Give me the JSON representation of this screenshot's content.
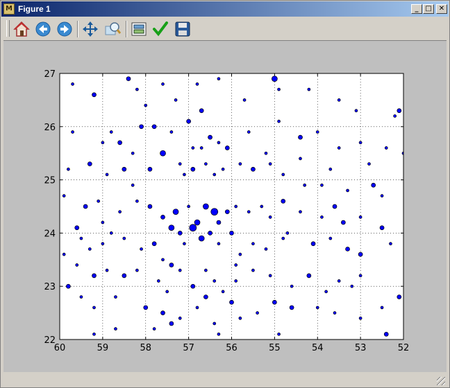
{
  "window": {
    "title": "Figure 1"
  },
  "titlebar_buttons": {
    "minimize": "_",
    "maximize": "□",
    "close": "✕"
  },
  "toolbar": {
    "items": [
      {
        "name": "home-icon",
        "tooltip": "Home"
      },
      {
        "name": "back-icon",
        "tooltip": "Back"
      },
      {
        "name": "forward-icon",
        "tooltip": "Forward"
      },
      {
        "name": "pan-icon",
        "tooltip": "Pan"
      },
      {
        "name": "zoom-icon",
        "tooltip": "Zoom"
      },
      {
        "name": "subplots-icon",
        "tooltip": "Configure subplots"
      },
      {
        "name": "edit-icon",
        "tooltip": "Edit"
      },
      {
        "name": "save-icon",
        "tooltip": "Save"
      }
    ]
  },
  "chart_data": {
    "type": "scatter",
    "title": "",
    "xlabel": "",
    "ylabel": "",
    "xlim": [
      60,
      52
    ],
    "ylim": [
      22,
      27
    ],
    "x_inverted": true,
    "xticks": [
      "60",
      "59",
      "58",
      "57",
      "56",
      "55",
      "54",
      "53",
      "52"
    ],
    "yticks": [
      "22",
      "23",
      "24",
      "25",
      "26",
      "27"
    ],
    "grid": true,
    "marker_color": "#0000ff",
    "marker_edge": "#000000",
    "points": [
      [
        59.7,
        26.8,
        2
      ],
      [
        59.2,
        26.6,
        3
      ],
      [
        58.4,
        26.9,
        3
      ],
      [
        58.2,
        26.7,
        2
      ],
      [
        57.6,
        26.8,
        2
      ],
      [
        56.7,
        26.3,
        3
      ],
      [
        56.3,
        26.9,
        2
      ],
      [
        55.0,
        26.9,
        4
      ],
      [
        54.9,
        26.7,
        2
      ],
      [
        54.2,
        26.7,
        2
      ],
      [
        53.5,
        26.5,
        2
      ],
      [
        53.1,
        26.3,
        2
      ],
      [
        52.1,
        26.3,
        3
      ],
      [
        52.2,
        26.2,
        2
      ],
      [
        59.7,
        25.9,
        2
      ],
      [
        59.0,
        25.7,
        2
      ],
      [
        58.6,
        25.7,
        3
      ],
      [
        58.1,
        26.0,
        3
      ],
      [
        57.8,
        26.0,
        3
      ],
      [
        57.4,
        25.9,
        2
      ],
      [
        56.9,
        25.6,
        2
      ],
      [
        56.5,
        25.8,
        3
      ],
      [
        56.3,
        25.7,
        2
      ],
      [
        56.1,
        25.6,
        3
      ],
      [
        55.6,
        25.9,
        2
      ],
      [
        54.9,
        26.1,
        2
      ],
      [
        54.4,
        25.8,
        3
      ],
      [
        54.0,
        25.9,
        2
      ],
      [
        53.5,
        25.6,
        2
      ],
      [
        53.0,
        25.7,
        2
      ],
      [
        52.4,
        25.6,
        2
      ],
      [
        52.0,
        25.5,
        2
      ],
      [
        59.8,
        25.2,
        2
      ],
      [
        59.3,
        25.3,
        3
      ],
      [
        58.9,
        25.1,
        2
      ],
      [
        58.5,
        25.2,
        3
      ],
      [
        58.3,
        25.5,
        2
      ],
      [
        57.9,
        25.2,
        3
      ],
      [
        57.6,
        25.5,
        4
      ],
      [
        57.2,
        25.3,
        2
      ],
      [
        56.9,
        25.2,
        3
      ],
      [
        56.6,
        25.3,
        2
      ],
      [
        56.4,
        25.1,
        2
      ],
      [
        56.2,
        25.2,
        2
      ],
      [
        55.8,
        25.3,
        2
      ],
      [
        55.5,
        25.2,
        3
      ],
      [
        55.1,
        25.3,
        2
      ],
      [
        54.8,
        25.1,
        2
      ],
      [
        54.3,
        24.9,
        2
      ],
      [
        53.7,
        25.2,
        2
      ],
      [
        53.3,
        24.8,
        2
      ],
      [
        52.7,
        24.9,
        3
      ],
      [
        52.5,
        24.7,
        2
      ],
      [
        59.9,
        24.7,
        2
      ],
      [
        59.4,
        24.5,
        3
      ],
      [
        59.1,
        24.6,
        2
      ],
      [
        58.6,
        24.4,
        2
      ],
      [
        58.2,
        24.6,
        2
      ],
      [
        57.9,
        24.5,
        3
      ],
      [
        57.6,
        24.3,
        3
      ],
      [
        57.3,
        24.4,
        4
      ],
      [
        57.0,
        24.5,
        2
      ],
      [
        56.8,
        24.2,
        4
      ],
      [
        56.6,
        24.5,
        4
      ],
      [
        56.4,
        24.4,
        5
      ],
      [
        56.3,
        24.2,
        3
      ],
      [
        56.1,
        24.4,
        3
      ],
      [
        55.9,
        24.5,
        2
      ],
      [
        55.6,
        24.4,
        2
      ],
      [
        55.3,
        24.5,
        2
      ],
      [
        55.1,
        24.3,
        2
      ],
      [
        54.8,
        24.6,
        3
      ],
      [
        54.4,
        24.4,
        2
      ],
      [
        53.9,
        24.3,
        2
      ],
      [
        53.6,
        24.5,
        3
      ],
      [
        53.4,
        24.2,
        3
      ],
      [
        53.0,
        24.3,
        2
      ],
      [
        52.5,
        24.1,
        3
      ],
      [
        59.6,
        24.1,
        3
      ],
      [
        59.5,
        23.9,
        2
      ],
      [
        59.3,
        23.7,
        2
      ],
      [
        59.0,
        23.8,
        2
      ],
      [
        58.8,
        24.0,
        2
      ],
      [
        58.5,
        23.9,
        2
      ],
      [
        58.1,
        23.7,
        2
      ],
      [
        57.8,
        23.8,
        3
      ],
      [
        57.6,
        23.5,
        2
      ],
      [
        57.4,
        24.1,
        4
      ],
      [
        57.2,
        24.0,
        3
      ],
      [
        57.1,
        23.8,
        2
      ],
      [
        56.9,
        24.1,
        5
      ],
      [
        56.7,
        23.9,
        4
      ],
      [
        56.5,
        24.0,
        3
      ],
      [
        56.3,
        23.8,
        2
      ],
      [
        56.0,
        24.0,
        3
      ],
      [
        55.8,
        23.6,
        2
      ],
      [
        55.5,
        23.8,
        2
      ],
      [
        55.2,
        23.7,
        2
      ],
      [
        54.8,
        23.9,
        2
      ],
      [
        54.1,
        23.8,
        3
      ],
      [
        53.7,
        23.9,
        2
      ],
      [
        53.3,
        23.7,
        3
      ],
      [
        53.0,
        23.6,
        3
      ],
      [
        59.6,
        23.4,
        2
      ],
      [
        59.2,
        23.2,
        3
      ],
      [
        58.9,
        23.3,
        2
      ],
      [
        58.5,
        23.2,
        3
      ],
      [
        58.2,
        23.3,
        2
      ],
      [
        57.7,
        23.1,
        2
      ],
      [
        57.4,
        23.4,
        3
      ],
      [
        57.2,
        23.3,
        2
      ],
      [
        56.9,
        23.0,
        3
      ],
      [
        56.6,
        23.3,
        2
      ],
      [
        56.4,
        23.1,
        2
      ],
      [
        56.2,
        22.9,
        2
      ],
      [
        55.9,
        23.1,
        2
      ],
      [
        55.5,
        23.3,
        2
      ],
      [
        55.1,
        23.2,
        2
      ],
      [
        54.6,
        23.0,
        2
      ],
      [
        54.2,
        23.2,
        3
      ],
      [
        53.8,
        22.9,
        2
      ],
      [
        53.5,
        23.1,
        2
      ],
      [
        53.0,
        23.2,
        2
      ],
      [
        52.1,
        22.8,
        3
      ],
      [
        59.8,
        23.0,
        3
      ],
      [
        59.5,
        22.8,
        2
      ],
      [
        59.2,
        22.6,
        2
      ],
      [
        58.7,
        22.8,
        2
      ],
      [
        58.0,
        22.6,
        3
      ],
      [
        57.6,
        22.5,
        3
      ],
      [
        57.2,
        22.4,
        2
      ],
      [
        56.8,
        22.6,
        2
      ],
      [
        56.4,
        22.3,
        2
      ],
      [
        56.0,
        22.7,
        3
      ],
      [
        55.4,
        22.5,
        2
      ],
      [
        55.0,
        22.7,
        3
      ],
      [
        54.6,
        22.6,
        3
      ],
      [
        54.0,
        22.6,
        2
      ],
      [
        53.6,
        22.5,
        2
      ],
      [
        53.0,
        22.4,
        2
      ],
      [
        52.5,
        22.6,
        2
      ],
      [
        59.2,
        22.1,
        2
      ],
      [
        58.7,
        22.2,
        2
      ],
      [
        57.8,
        22.2,
        2
      ],
      [
        57.4,
        22.3,
        3
      ],
      [
        56.3,
        22.1,
        2
      ],
      [
        55.8,
        22.4,
        2
      ],
      [
        52.4,
        22.1,
        3
      ],
      [
        58.0,
        26.4,
        2
      ],
      [
        55.7,
        26.5,
        2
      ],
      [
        57.1,
        25.1,
        2
      ],
      [
        58.3,
        24.9,
        2
      ],
      [
        55.2,
        25.5,
        2
      ],
      [
        57.0,
        26.1,
        3
      ],
      [
        53.9,
        24.9,
        2
      ],
      [
        56.7,
        25.6,
        2
      ],
      [
        59.0,
        24.2,
        2
      ],
      [
        54.7,
        24.0,
        2
      ],
      [
        55.9,
        23.4,
        2
      ],
      [
        57.5,
        22.9,
        2
      ],
      [
        53.2,
        23.0,
        2
      ],
      [
        52.3,
        23.8,
        2
      ],
      [
        56.6,
        22.8,
        3
      ],
      [
        54.4,
        25.4,
        2
      ],
      [
        58.8,
        25.9,
        2
      ],
      [
        57.3,
        26.5,
        2
      ],
      [
        52.8,
        25.3,
        2
      ],
      [
        56.8,
        26.8,
        2
      ],
      [
        54.9,
        22.1,
        2
      ],
      [
        59.9,
        23.6,
        2
      ]
    ]
  }
}
